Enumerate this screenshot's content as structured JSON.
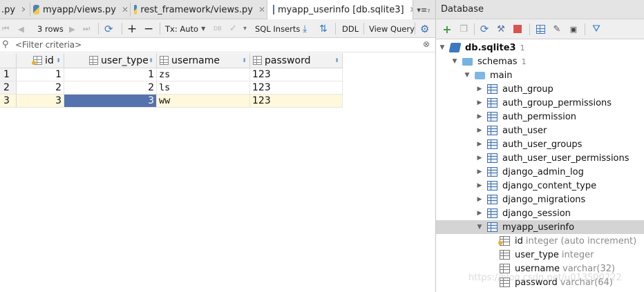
{
  "tabs": [
    {
      "label": ".py",
      "icon": "python-file-icon"
    },
    {
      "label": "myapp/views.py",
      "icon": "python-file-icon"
    },
    {
      "label": "rest_framework/views.py",
      "icon": "python-file-icon"
    },
    {
      "label": "myapp_userinfo [db.sqlite3]",
      "icon": "table-icon",
      "active": true
    }
  ],
  "tab_more_label": "▾≡₇",
  "toolbar": {
    "rows_label": "3 rows",
    "tx_label": "Tx: Auto",
    "db_label": "DB",
    "sql_inserts_label": "SQL Inserts",
    "ddl_label": "DDL",
    "view_query_label": "View Query"
  },
  "filter": {
    "placeholder": "<Filter criteria>"
  },
  "table": {
    "columns": [
      {
        "name": "id",
        "icon": "primary-key-icon"
      },
      {
        "name": "user_type",
        "icon": "column-icon"
      },
      {
        "name": "username",
        "icon": "column-icon"
      },
      {
        "name": "password",
        "icon": "column-icon"
      }
    ],
    "rows": [
      {
        "num": "1",
        "id": "1",
        "user_type": "1",
        "username": "zs",
        "password": "123"
      },
      {
        "num": "2",
        "id": "2",
        "user_type": "2",
        "username": "ls",
        "password": "123"
      },
      {
        "num": "3",
        "id": "3",
        "user_type": "3",
        "username": "ww",
        "password": "123"
      }
    ]
  },
  "database_panel": {
    "title": "Database",
    "tree": {
      "db": {
        "name": "db.sqlite3",
        "count": "1"
      },
      "schemas": {
        "name": "schemas",
        "count": "1"
      },
      "main": {
        "name": "main"
      },
      "tables": [
        "auth_group",
        "auth_group_permissions",
        "auth_permission",
        "auth_user",
        "auth_user_groups",
        "auth_user_user_permissions",
        "django_admin_log",
        "django_content_type",
        "django_migrations",
        "django_session",
        "myapp_userinfo"
      ],
      "fields": [
        {
          "name": "id",
          "type": "integer (auto increment)"
        },
        {
          "name": "user_type",
          "type": "integer"
        },
        {
          "name": "username",
          "type": "varchar(32)"
        },
        {
          "name": "password",
          "type": "varchar(64)"
        }
      ]
    }
  },
  "watermark": "https://blog.csdn.net/u013500222",
  "colors": {
    "selection": "#5472ad",
    "current_row": "#fff8dc",
    "tree_selected": "#d4d4d4"
  }
}
